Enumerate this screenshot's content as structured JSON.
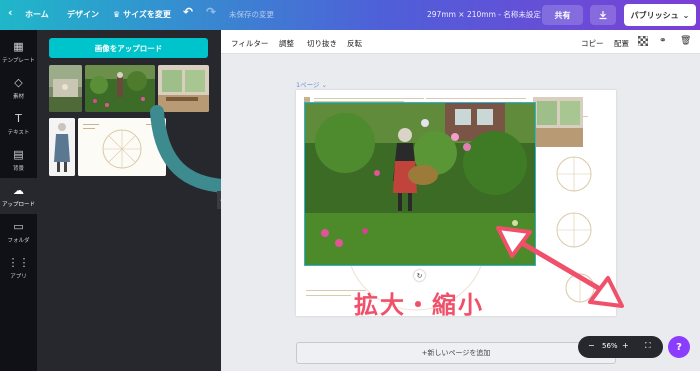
{
  "topbar": {
    "home_label": "ホーム",
    "design_label": "デザイン",
    "resize_label": "サイズを変更",
    "unsaved_label": "未保存の変更",
    "size_label": "297mm × 210mm - 名称未設定",
    "share_label": "共有",
    "publish_label": "パブリッシュ"
  },
  "rail": {
    "items": [
      {
        "label": "テンプレート",
        "icon": "template-icon"
      },
      {
        "label": "素材",
        "icon": "elements-icon"
      },
      {
        "label": "テキスト",
        "icon": "text-icon"
      },
      {
        "label": "背景",
        "icon": "background-icon"
      },
      {
        "label": "アップロード",
        "icon": "upload-icon"
      },
      {
        "label": "フォルダ",
        "icon": "folder-icon"
      },
      {
        "label": "アプリ",
        "icon": "apps-icon"
      }
    ]
  },
  "panel": {
    "upload_button": "画像をアップロード"
  },
  "toolbar": {
    "filter": "フィルター",
    "adjust": "調整",
    "crop": "切り抜き",
    "flip": "反転",
    "copy": "コピー",
    "arrange": "配置"
  },
  "canvas": {
    "page_label": "1ページ ⌄",
    "add_page": "+新しいページを追加"
  },
  "zoom": {
    "minus": "−",
    "value": "56%",
    "plus": "+"
  },
  "help": "?",
  "annotation": "拡大・縮小",
  "colors": {
    "accent": "#00c4cc",
    "selection": "#28b6d6",
    "annotation": "#f0506a",
    "arrow": "#3d8a8f",
    "help": "#8b3dff"
  }
}
